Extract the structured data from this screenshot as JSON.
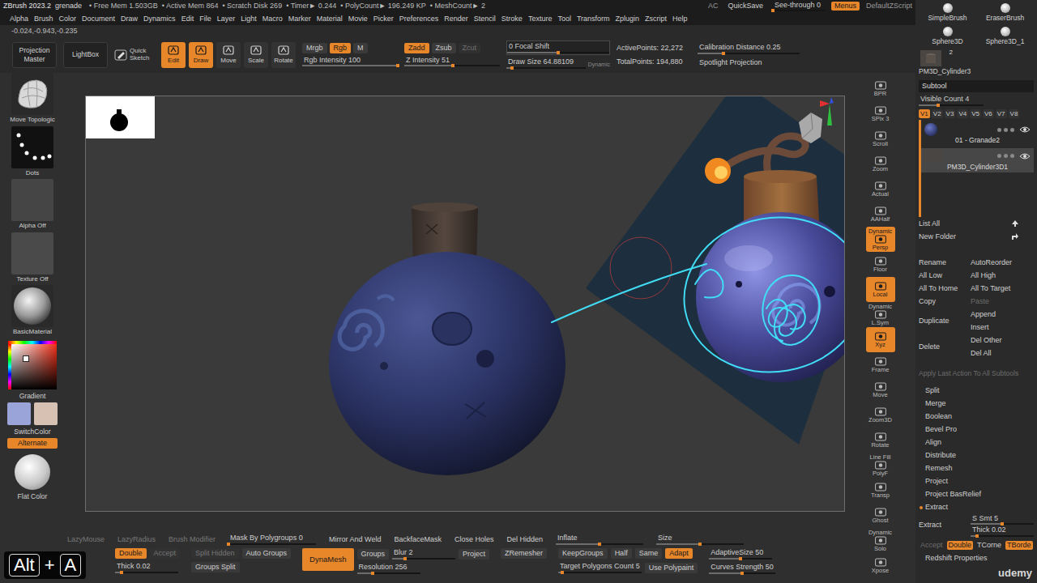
{
  "menubar": {
    "app": "ZBrush 2023.2",
    "document": "grenade",
    "stats": [
      "• Free Mem 1.503GB",
      "• Active Mem 864",
      "• Scratch Disk 269",
      "• Timer► 0.244",
      "• PolyCount► 196.249 KP",
      "• MeshCount► 2"
    ],
    "right": [
      {
        "label": "AC",
        "kind": "text",
        "on": false
      },
      {
        "label": "QuickSave",
        "kind": "button",
        "on": false
      },
      {
        "label": "See-through 0",
        "kind": "slider",
        "level": 0
      },
      {
        "label": "Menus",
        "kind": "button",
        "on": true
      },
      {
        "label": "DefaultZScript",
        "kind": "text",
        "on": false
      }
    ],
    "menus": [
      "Alpha",
      "Brush",
      "Color",
      "Document",
      "Draw",
      "Dynamics",
      "Edit",
      "File",
      "Layer",
      "Light",
      "Macro",
      "Marker",
      "Material",
      "Movie",
      "Picker",
      "Preferences",
      "Render",
      "Stencil",
      "Stroke",
      "Texture",
      "Tool",
      "Transform",
      "Zplugin",
      "Zscript",
      "Help"
    ]
  },
  "coordinates": "-0.024,-0.943,-0.235",
  "shelf": {
    "launchers": [
      {
        "label": "Projection Master"
      },
      {
        "label": "LightBox"
      }
    ],
    "quick_sketch": {
      "label": "Quick Sketch"
    },
    "modes": [
      {
        "label": "Edit",
        "selected": true
      },
      {
        "label": "Draw",
        "selected": true
      },
      {
        "label": "Move",
        "selected": false
      },
      {
        "label": "Scale",
        "selected": false
      },
      {
        "label": "Rotate",
        "selected": false
      }
    ],
    "channels": [
      {
        "toggles": [
          {
            "label": "Mrgb",
            "on": false,
            "disabled": false
          },
          {
            "label": "Rgb",
            "on": true,
            "disabled": false
          },
          {
            "label": "M",
            "on": false,
            "disabled": false
          }
        ],
        "slider": {
          "label": "Rgb Intensity 100",
          "level": 1
        }
      },
      {
        "toggles": [
          {
            "label": "Zadd",
            "on": true,
            "disabled": false
          },
          {
            "label": "Zsub",
            "on": false,
            "disabled": false
          },
          {
            "label": "Zcut",
            "on": false,
            "disabled": true
          }
        ],
        "slider": {
          "label": "Z Intensity 51",
          "level": 0.51
        }
      }
    ],
    "focal_shift": {
      "label": "0 Focal Shift",
      "level": 0.5
    },
    "draw_size": {
      "label": "Draw Size 64.88109",
      "level": 0.07
    },
    "dynamic": {
      "label": "Dynamic",
      "on": false
    },
    "points": [
      "ActivePoints: 22,272",
      "TotalPoints: 194,880"
    ],
    "calibration": {
      "label": "Calibration Distance 0.25",
      "level": 0.25
    },
    "spotlight": {
      "label": "Spotlight Projection"
    }
  },
  "left_shelf": {
    "slots": [
      {
        "label": "Move Topologic",
        "kind": "brush"
      },
      {
        "label": "Dots",
        "kind": "stroke"
      },
      {
        "label": "Alpha Off",
        "kind": "alpha"
      },
      {
        "label": "Texture Off",
        "kind": "texture"
      },
      {
        "label": "BasicMaterial",
        "kind": "material"
      }
    ],
    "gradient_label": "Gradient",
    "swatches": [
      {
        "color": "#9aa4d8"
      },
      {
        "color": "#d6c1b2"
      }
    ],
    "switch_color": "SwitchColor",
    "alternate": {
      "label": "Alternate",
      "on": true
    },
    "flat_color": "Flat Color"
  },
  "right_shelf": [
    {
      "label": "BPR",
      "on": false
    },
    {
      "label": "SPix 3",
      "on": false
    },
    {
      "label": "Scroll",
      "on": false
    },
    {
      "label": "Zoom",
      "on": false
    },
    {
      "label": "Actual",
      "on": false
    },
    {
      "label": "AAHalf",
      "on": false
    },
    {
      "label": "Persp",
      "caption": "Dynamic",
      "on": true
    },
    {
      "label": "Floor",
      "on": false
    },
    {
      "label": "Local",
      "on": true
    },
    {
      "label": "L.Sym",
      "caption": "Dynamic",
      "on": false
    },
    {
      "label": "Xyz",
      "on": true
    },
    {
      "label": "Frame",
      "on": false
    },
    {
      "label": "Move",
      "on": false
    },
    {
      "label": "Zoom3D",
      "on": false
    },
    {
      "label": "Rotate",
      "on": false
    },
    {
      "label": "PolyF",
      "caption": "Line Fill",
      "on": false
    },
    {
      "label": "Transp",
      "on": false
    },
    {
      "label": "Ghost",
      "on": false
    },
    {
      "label": "Solo",
      "caption": "Dynamic",
      "on": false
    },
    {
      "label": "Xpose",
      "on": false
    }
  ],
  "right_panel": {
    "tools": [
      {
        "label": "SimpleBrush",
        "kind": "sphere"
      },
      {
        "label": "EraserBrush",
        "kind": "sphere"
      },
      {
        "label": "Sphere3D",
        "kind": "sphere"
      },
      {
        "label": "Sphere3D_1",
        "kind": "sphere"
      },
      {
        "label": "PM3D_Cylinder3",
        "kind": "mesh",
        "badge": "2"
      }
    ],
    "subtool_title": "Subtool",
    "visible_count": {
      "label": "Visible Count 4",
      "level": 0.3
    },
    "versions": [
      {
        "label": "V1",
        "selected": true
      },
      {
        "label": "V2",
        "selected": false
      },
      {
        "label": "V3",
        "selected": false
      },
      {
        "label": "V4",
        "selected": false
      },
      {
        "label": "V5",
        "selected": false
      },
      {
        "label": "V6",
        "selected": false
      },
      {
        "label": "V7",
        "selected": false
      },
      {
        "label": "V8",
        "selected": false
      }
    ],
    "subtools": [
      {
        "name": "01 - Granade2",
        "kind": "sphere",
        "selected": false,
        "visible": true
      },
      {
        "name": "PM3D_Cylinder3D1",
        "kind": "mesh",
        "selected": true,
        "visible": true
      }
    ],
    "list_all": "List All",
    "new_folder": "New Folder",
    "actions": [
      {
        "main": {
          "label": "Rename",
          "disabled": false
        },
        "side": [
          {
            "label": "AutoReorder",
            "disabled": false
          }
        ]
      },
      {
        "main": {
          "label": "All Low",
          "disabled": false
        },
        "side": [
          {
            "label": "All High",
            "disabled": false
          }
        ]
      },
      {
        "main": {
          "label": "All To Home",
          "disabled": false
        },
        "side": [
          {
            "label": "All To Target",
            "disabled": false
          }
        ]
      },
      {
        "main": {
          "label": "Copy",
          "disabled": false
        },
        "side": [
          {
            "label": "Paste",
            "disabled": true
          }
        ]
      },
      {
        "main": {
          "label": "Duplicate",
          "disabled": false
        },
        "side": [
          {
            "label": "Append",
            "disabled": false
          },
          {
            "label": "Insert",
            "disabled": false
          }
        ]
      },
      {
        "main": {
          "label": "Delete",
          "disabled": false
        },
        "side": [
          {
            "label": "Del Other",
            "disabled": false
          },
          {
            "label": "Del All",
            "disabled": false
          }
        ]
      }
    ],
    "apply_all": {
      "label": "Apply Last Action To All Subtools",
      "disabled": true
    },
    "sections": [
      {
        "label": "Split",
        "expanded": false
      },
      {
        "label": "Merge",
        "expanded": false
      },
      {
        "label": "Boolean",
        "expanded": false
      },
      {
        "label": "Bevel Pro",
        "expanded": false
      },
      {
        "label": "Align",
        "expanded": false
      },
      {
        "label": "Distribute",
        "expanded": false
      },
      {
        "label": "Remesh",
        "expanded": false
      },
      {
        "label": "Project",
        "expanded": false
      },
      {
        "label": "Project BasRelief",
        "expanded": false
      },
      {
        "label": "Extract",
        "expanded": true
      }
    ],
    "extract": {
      "button": "Extract",
      "sliders": [
        {
          "label": "S Smt 5",
          "level": 0.5
        },
        {
          "label": "Thick 0.02",
          "level": 0.1
        }
      ],
      "toggles": [
        {
          "label": "Accept",
          "on": false,
          "disabled": true
        },
        {
          "label": "Double",
          "on": true,
          "disabled": false
        },
        {
          "label": "TCorne",
          "on": false,
          "disabled": false
        },
        {
          "label": "TBorde",
          "on": true,
          "disabled": false
        }
      ]
    },
    "after": [
      {
        "label": "Redshift Properties",
        "expanded": false
      }
    ]
  },
  "bottom_tray": {
    "top_row": [
      {
        "label": "LazyMouse",
        "kind": "button",
        "on": false,
        "disabled": true
      },
      {
        "label": "LazyRadius",
        "kind": "button",
        "on": false,
        "disabled": true
      },
      {
        "label": "Brush Modifier",
        "kind": "button",
        "on": false,
        "disabled": true
      },
      {
        "label": "Mask By Polygroups 0",
        "kind": "slider",
        "level": 0
      },
      {
        "label": "Mirror And Weld",
        "kind": "button",
        "on": false,
        "disabled": false
      },
      {
        "label": "BackfaceMask",
        "kind": "button",
        "on": false,
        "disabled": false
      },
      {
        "label": "Close Holes",
        "kind": "button",
        "on": false,
        "disabled": false
      },
      {
        "label": "Del Hidden",
        "kind": "button",
        "on": false,
        "disabled": false
      },
      {
        "label": "Inflate",
        "kind": "slider",
        "level": 0.5
      },
      {
        "label": "Size",
        "kind": "slider",
        "level": 0.5
      }
    ],
    "groups": [
      {
        "rows": [
          [
            {
              "label": "Double",
              "kind": "button",
              "on": true,
              "disabled": false
            },
            {
              "label": "Accept",
              "kind": "button",
              "on": false,
              "disabled": true
            }
          ],
          [
            {
              "label": "Thick 0.02",
              "kind": "slider",
              "level": 0.1
            }
          ]
        ]
      },
      {
        "rows": [
          [
            {
              "label": "Split Hidden",
              "kind": "button",
              "on": false,
              "disabled": true
            },
            {
              "label": "Auto Groups",
              "kind": "button",
              "on": false,
              "disabled": false
            }
          ],
          [
            {
              "label": "Groups Split",
              "kind": "button",
              "on": false,
              "disabled": false
            }
          ]
        ]
      },
      {
        "big": {
          "label": "DynaMesh",
          "on": true
        },
        "rows": [
          [
            {
              "label": "Groups",
              "kind": "button",
              "on": false,
              "disabled": false
            },
            {
              "label": "Blur 2",
              "kind": "slider",
              "level": 0.2
            },
            {
              "label": "Project",
              "kind": "button",
              "on": false,
              "disabled": false
            }
          ],
          [
            {
              "label": "Resolution 256",
              "kind": "slider",
              "level": 0.25
            }
          ]
        ]
      },
      {
        "rows": [
          [
            {
              "label": "ZRemesher",
              "kind": "button",
              "on": false,
              "disabled": false
            }
          ]
        ]
      },
      {
        "rows": [
          [
            {
              "label": "KeepGroups",
              "kind": "button",
              "on": false,
              "disabled": false
            },
            {
              "label": "Half",
              "kind": "button",
              "on": false,
              "disabled": false
            },
            {
              "label": "Same",
              "kind": "button",
              "on": false,
              "disabled": false
            },
            {
              "label": "Adapt",
              "kind": "button",
              "on": true,
              "disabled": false
            }
          ],
          [
            {
              "label": "Target Polygons Count 5",
              "kind": "slider",
              "level": 0.05
            },
            {
              "label": "Use Polypaint",
              "kind": "button",
              "on": false,
              "disabled": false
            }
          ]
        ]
      },
      {
        "rows": [
          [
            {
              "label": "AdaptiveSize 50",
              "kind": "slider",
              "level": 0.5
            }
          ],
          [
            {
              "label": "Curves Strength 50",
              "kind": "slider",
              "level": 0.5
            }
          ]
        ]
      }
    ]
  },
  "key_overlay": {
    "keys": [
      "Alt",
      "A"
    ],
    "joiner": "+"
  },
  "watermark": "udemy"
}
